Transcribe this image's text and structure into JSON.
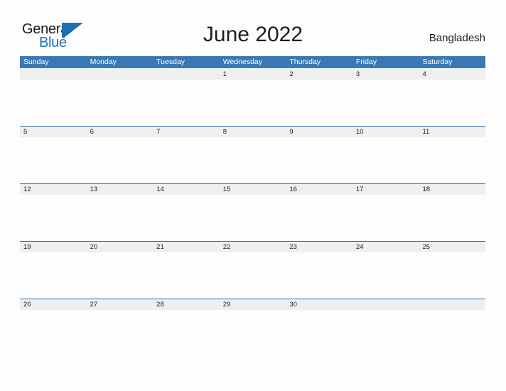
{
  "logo": {
    "word_one": "General",
    "word_two": "Blue",
    "flag_icon": "flag-triangle-icon",
    "blue": "#1f6fb5"
  },
  "header": {
    "title": "June 2022",
    "region": "Bangladesh"
  },
  "colors": {
    "weekday_header_bg": "#3a78b5",
    "week_rule": "#2d6ca4",
    "date_band_bg": "#efefef",
    "page_bg": "#fdfdfd",
    "text": "#1d1d1d"
  },
  "calendar": {
    "weekdays": [
      "Sunday",
      "Monday",
      "Tuesday",
      "Wednesday",
      "Thursday",
      "Friday",
      "Saturday"
    ],
    "weeks": [
      [
        "",
        "",
        "",
        "1",
        "2",
        "3",
        "4"
      ],
      [
        "5",
        "6",
        "7",
        "8",
        "9",
        "10",
        "11"
      ],
      [
        "12",
        "13",
        "14",
        "15",
        "16",
        "17",
        "18"
      ],
      [
        "19",
        "20",
        "21",
        "22",
        "23",
        "24",
        "25"
      ],
      [
        "26",
        "27",
        "28",
        "29",
        "30",
        "",
        ""
      ]
    ]
  }
}
